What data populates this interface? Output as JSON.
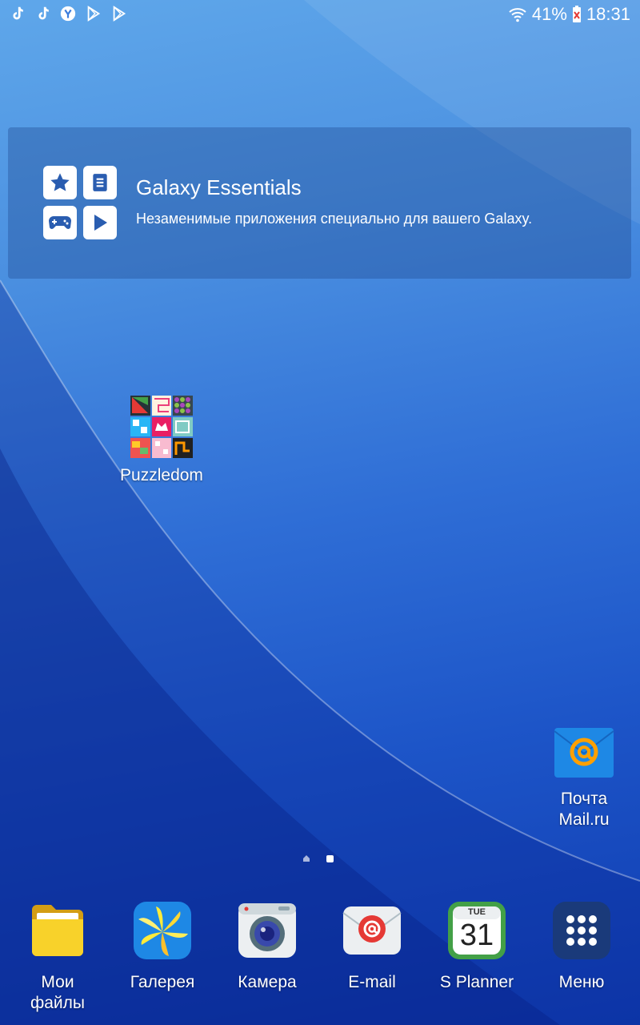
{
  "status_bar": {
    "notification_icons": [
      "tiktok-icon",
      "tiktok-icon",
      "yandex-icon",
      "play-store-icon",
      "play-store-icon"
    ],
    "battery_percent": "41%",
    "time": "18:31"
  },
  "widget": {
    "title": "Galaxy Essentials",
    "description": "Незаменимые приложения специально для вашего Galaxy."
  },
  "home_apps": {
    "puzzledom": "Puzzledom",
    "mail_ru_line1": "Почта",
    "mail_ru_line2": "Mail.ru"
  },
  "dock": {
    "my_files_line1": "Мои",
    "my_files_line2": "файлы",
    "gallery": "Галерея",
    "camera": "Камера",
    "email": "E-mail",
    "splanner": "S Planner",
    "splanner_day": "TUE",
    "splanner_date": "31",
    "menu": "Меню"
  },
  "colors": {
    "accent_mail": "#1e88e5",
    "folder_yellow": "#f5c518"
  }
}
